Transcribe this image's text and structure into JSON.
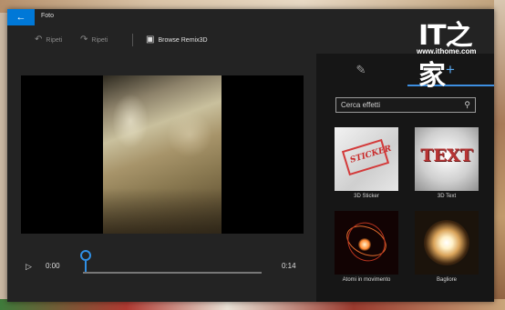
{
  "window": {
    "title": "Foto"
  },
  "toolbar": {
    "undo_label": "Ripeti",
    "redo_label": "Ripeti",
    "remix_label": "Browse Remix3D"
  },
  "player": {
    "current_time": "0:00",
    "duration": "0:14",
    "progress": 0.0
  },
  "panel": {
    "search_placeholder": "Cerca effetti",
    "effects": [
      {
        "label": "3D Sticker",
        "thumb_text": "STICKER"
      },
      {
        "label": "3D Text",
        "thumb_text": "TEXT"
      },
      {
        "label": "Atomi in movimento"
      },
      {
        "label": "Bagliore"
      }
    ]
  },
  "watermark": {
    "logo": "IT之家",
    "url": "www.ithome.com"
  },
  "colors": {
    "accent": "#0078d7",
    "window_bg": "#232323",
    "panel_bg": "#161616"
  }
}
